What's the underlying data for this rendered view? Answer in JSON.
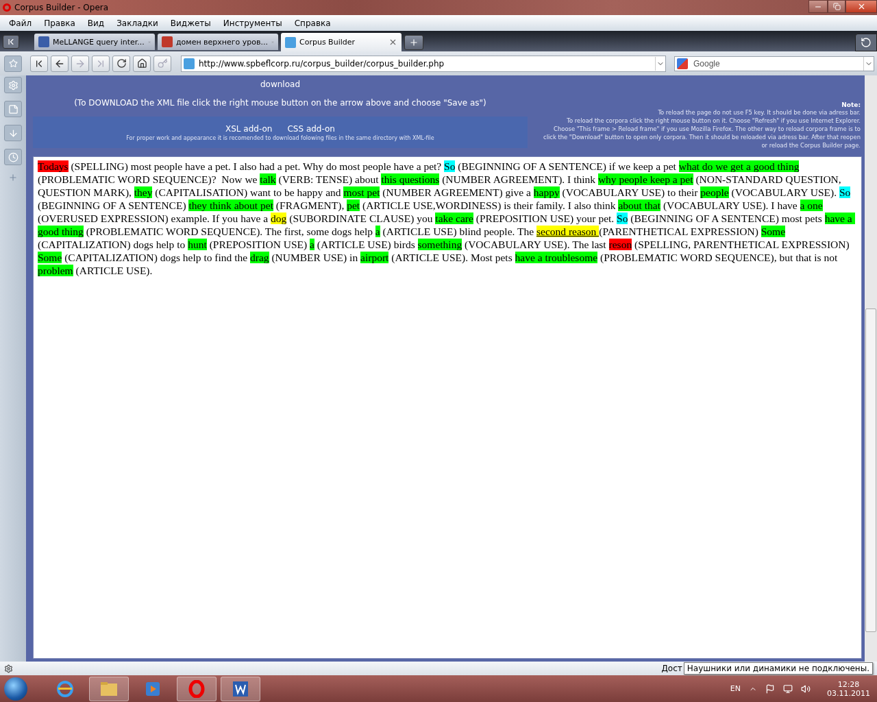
{
  "window": {
    "title": "Corpus Builder - Opera"
  },
  "menu": [
    "Файл",
    "Правка",
    "Вид",
    "Закладки",
    "Виджеты",
    "Инструменты",
    "Справка"
  ],
  "tabs": [
    {
      "label": "MeLLANGE query inter...",
      "selected": false
    },
    {
      "label": "домен верхнего уров...",
      "selected": false
    },
    {
      "label": "Corpus Builder",
      "selected": true
    }
  ],
  "address": {
    "url": "http://www.spbeflcorp.ru/corpus_builder/corpus_builder.php"
  },
  "search": {
    "placeholder": "Google"
  },
  "header": {
    "download_link": "download",
    "download_hint": "(To DOWNLOAD the XML file click the right mouse button on the arrow above and choose \"Save as\")",
    "addons": [
      "XSL add-on",
      "CSS add-on"
    ],
    "addons_hint": "For proper work and appearance it is recomended to download folowing files in the same directory with XML-file",
    "note_title": "Note:",
    "note_lines": [
      "To reload the page do not use F5 key. It should be done via adress bar.",
      "To reload the corpora click the right mouse button on it. Choose \"Refresh\" if you use Internet Explorer.",
      "Choose \"This frame > Reload frame\" if you use Mozilla Firefox. The other way to reload corpora frame is to",
      "click the \"Download\" button to open only corpora. Then it should be reloaded via adress bar. After that reopen",
      "or reload the Corpus Builder page."
    ]
  },
  "essay": [
    {
      "text": "Todays",
      "color": "#ff0000"
    },
    {
      "text": " (SPELLING) most people have a pet. I also had a pet. Why do most people have a pet? "
    },
    {
      "text": "So",
      "color": "#00ffff"
    },
    {
      "text": " (BEGINNING OF A SENTENCE) if we keep a pet "
    },
    {
      "text": "what do we get a good thing",
      "color": "#00ff00"
    },
    {
      "text": " (PROBLEMATIC WORD SEQUENCE)?  Now we "
    },
    {
      "text": "talk",
      "color": "#00ff00"
    },
    {
      "text": " (VERB: TENSE) about "
    },
    {
      "text": "this questions",
      "color": "#00ff00"
    },
    {
      "text": " (NUMBER AGREEMENT). I think "
    },
    {
      "text": "why people keep a pet",
      "color": "#00ff00"
    },
    {
      "text": " (NON-STANDARD QUESTION, QUESTION MARK), "
    },
    {
      "text": "they",
      "color": "#00ff00"
    },
    {
      "text": " (CAPITALISATION) want to be happy and "
    },
    {
      "text": "most pet",
      "color": "#00ff00"
    },
    {
      "text": " (NUMBER AGREEMENT) give a "
    },
    {
      "text": "happy",
      "color": "#00ff00"
    },
    {
      "text": " (VOCABULARY USE) to their "
    },
    {
      "text": "people",
      "color": "#00ff00"
    },
    {
      "text": " (VOCABULARY USE). "
    },
    {
      "text": "So",
      "color": "#00ffff"
    },
    {
      "text": " (BEGINNING OF A SENTENCE) "
    },
    {
      "text": "they think about pet",
      "color": "#00ff00"
    },
    {
      "text": " (FRAGMENT), "
    },
    {
      "text": "pet",
      "color": "#00ff00"
    },
    {
      "text": " (ARTICLE USE,WORDINESS) is their family. I also think "
    },
    {
      "text": "about that",
      "color": "#00ff00"
    },
    {
      "text": " (VOCABULARY USE). I have "
    },
    {
      "text": "a one",
      "color": "#00ff00"
    },
    {
      "text": " (OVERUSED EXPRESSION) example. If you have a "
    },
    {
      "text": "dog",
      "color": "#ffff00"
    },
    {
      "text": " (SUBORDINATE CLAUSE) you "
    },
    {
      "text": "take care",
      "color": "#00ff00"
    },
    {
      "text": " (PREPOSITION USE) your pet. "
    },
    {
      "text": "So",
      "color": "#00ffff"
    },
    {
      "text": " (BEGINNING OF A SENTENCE) most pets "
    },
    {
      "text": "have a good thing",
      "color": "#00ff00"
    },
    {
      "text": " (PROBLEMATIC WORD SEQUENCE). The first, some dogs help "
    },
    {
      "text": "a",
      "color": "#00ff00"
    },
    {
      "text": " (ARTICLE USE) blind people. The "
    },
    {
      "text": "second reason ",
      "color": "#ffff00",
      "underlined": true
    },
    {
      "text": "(PARENTHETICAL EXPRESSION) "
    },
    {
      "text": "Some",
      "color": "#00ff00"
    },
    {
      "text": " (CAPITALIZATION) dogs help to "
    },
    {
      "text": "hunt",
      "color": "#00ff00"
    },
    {
      "text": " (PREPOSITION USE) "
    },
    {
      "text": "a",
      "color": "#00ff00"
    },
    {
      "text": " (ARTICLE USE) birds "
    },
    {
      "text": "something",
      "color": "#00ff00"
    },
    {
      "text": " (VOCABULARY USE). The last "
    },
    {
      "text": "reson",
      "color": "#ff0000"
    },
    {
      "text": " (SPELLING, PARENTHETICAL EXPRESSION) "
    },
    {
      "text": "Some",
      "color": "#00ff00"
    },
    {
      "text": " (CAPITALIZATION) dogs help to find the "
    },
    {
      "text": "drag",
      "color": "#00ff00"
    },
    {
      "text": " (NUMBER USE) in "
    },
    {
      "text": "airport",
      "color": "#00ff00"
    },
    {
      "text": " (ARTICLE USE). Most pets "
    },
    {
      "text": "have a troublesome",
      "color": "#00ff00"
    },
    {
      "text": " (PROBLEMATIC WORD SEQUENCE), but that is not "
    },
    {
      "text": "problem",
      "color": "#00ff00"
    },
    {
      "text": " (ARTICLE USE)."
    }
  ],
  "status_bar": {
    "text": "Дост",
    "tooltip": "Наушники или динамики не подключены."
  },
  "taskbar": {
    "language": "EN",
    "time": "12:28",
    "date": "03.11.2011"
  }
}
